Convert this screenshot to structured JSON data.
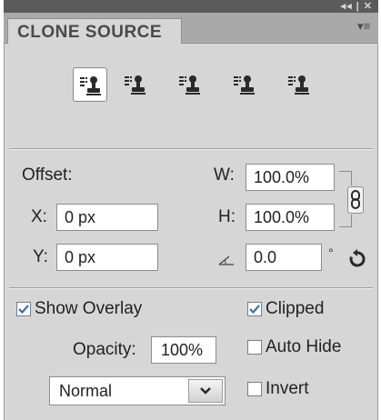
{
  "panel": {
    "title": "CLONE SOURCE",
    "top_controls": "◂◂ | ✕",
    "menu_glyph": "▾≡"
  },
  "sources": {
    "count": 5,
    "active_index": 0
  },
  "offset": {
    "label": "Offset:",
    "x_label": "X:",
    "x_value": "0 px",
    "y_label": "Y:",
    "y_value": "0 px",
    "w_label": "W:",
    "w_value": "100.0%",
    "h_label": "H:",
    "h_value": "100.0%",
    "angle_value": "0.0",
    "degree_symbol": "°"
  },
  "overlay": {
    "show_overlay_label": "Show Overlay",
    "show_overlay_checked": true,
    "opacity_label": "Opacity:",
    "opacity_value": "100%",
    "clipped_label": "Clipped",
    "clipped_checked": true,
    "auto_hide_label": "Auto Hide",
    "auto_hide_checked": false,
    "invert_label": "Invert",
    "invert_checked": false,
    "blend_mode": "Normal"
  },
  "colors": {
    "panel_bg": "#d6d6d6",
    "check_color": "#3a6fb5"
  }
}
